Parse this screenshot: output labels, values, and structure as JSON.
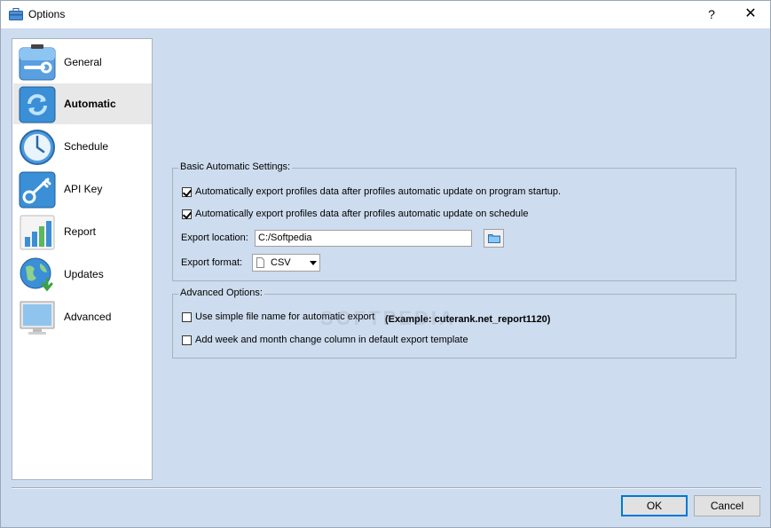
{
  "window": {
    "title": "Options",
    "help_label": "?",
    "close_label": "✕"
  },
  "sidebar": {
    "items": [
      {
        "label": "General",
        "icon": "wrench-icon",
        "selected": false
      },
      {
        "label": "Automatic",
        "icon": "refresh-icon",
        "selected": true
      },
      {
        "label": "Schedule",
        "icon": "clock-icon",
        "selected": false
      },
      {
        "label": "API Key",
        "icon": "key-icon",
        "selected": false
      },
      {
        "label": "Report",
        "icon": "bar-chart-icon",
        "selected": false
      },
      {
        "label": "Updates",
        "icon": "globe-download-icon",
        "selected": false
      },
      {
        "label": "Advanced",
        "icon": "monitor-icon",
        "selected": false
      }
    ]
  },
  "basic": {
    "legend": "Basic Automatic Settings:",
    "export_on_startup": {
      "label": "Automatically export profiles data after profiles automatic update on program startup.",
      "checked": true
    },
    "export_on_schedule": {
      "label": "Automatically export profiles data after profiles automatic update on schedule",
      "checked": true
    },
    "export_location_label": "Export location:",
    "export_location_value": "C:/Softpedia",
    "export_format_label": "Export format:",
    "export_format_value": "CSV"
  },
  "advanced": {
    "legend": "Advanced Options:",
    "simple_file_name": {
      "label": "Use simple file name for automatic export",
      "checked": false
    },
    "example_text": "(Example: cuterank.net_report1120)",
    "week_month_column": {
      "label": "Add week and month change column in default export template",
      "checked": false
    }
  },
  "footer": {
    "ok_label": "OK",
    "cancel_label": "Cancel"
  },
  "watermark_text": "SOFTPEDIA",
  "colors": {
    "background": "#cddcee",
    "selection": "#e8e8e8",
    "accent": "#0078d7"
  }
}
